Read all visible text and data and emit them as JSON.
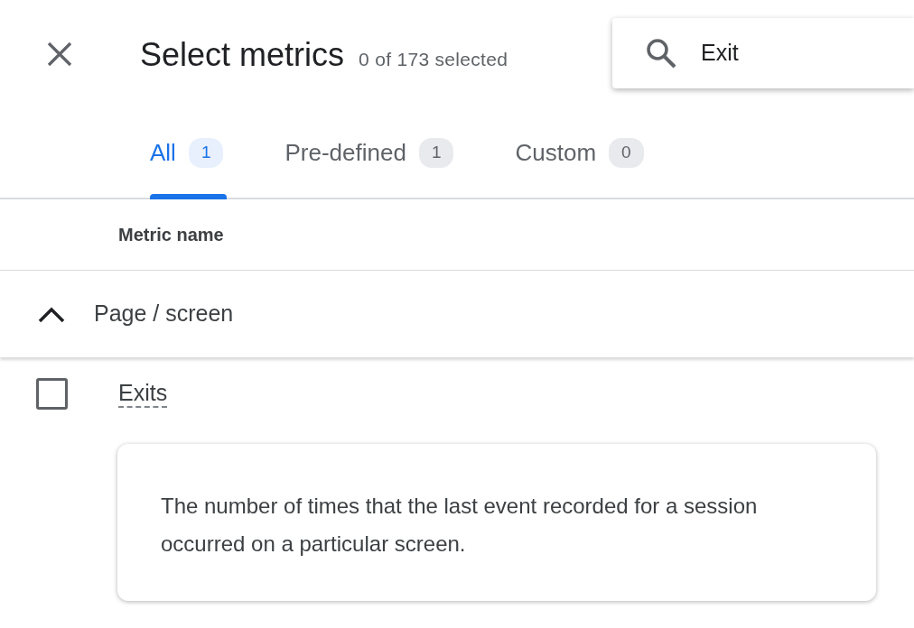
{
  "header": {
    "title": "Select metrics",
    "count": "0 of 173 selected"
  },
  "search": {
    "value": "Exit"
  },
  "tabs": [
    {
      "label": "All",
      "count": "1",
      "selected": true
    },
    {
      "label": "Pre-defined",
      "count": "1",
      "selected": false
    },
    {
      "label": "Custom",
      "count": "0",
      "selected": false
    }
  ],
  "table": {
    "columns": [
      "Metric name"
    ],
    "groups": [
      {
        "name": "Page / screen",
        "expanded": true,
        "metrics": [
          {
            "name": "Exits",
            "checked": false
          }
        ]
      }
    ]
  },
  "tooltip": {
    "text": "The number of times that the last event recorded for a session occurred on a particular screen."
  }
}
